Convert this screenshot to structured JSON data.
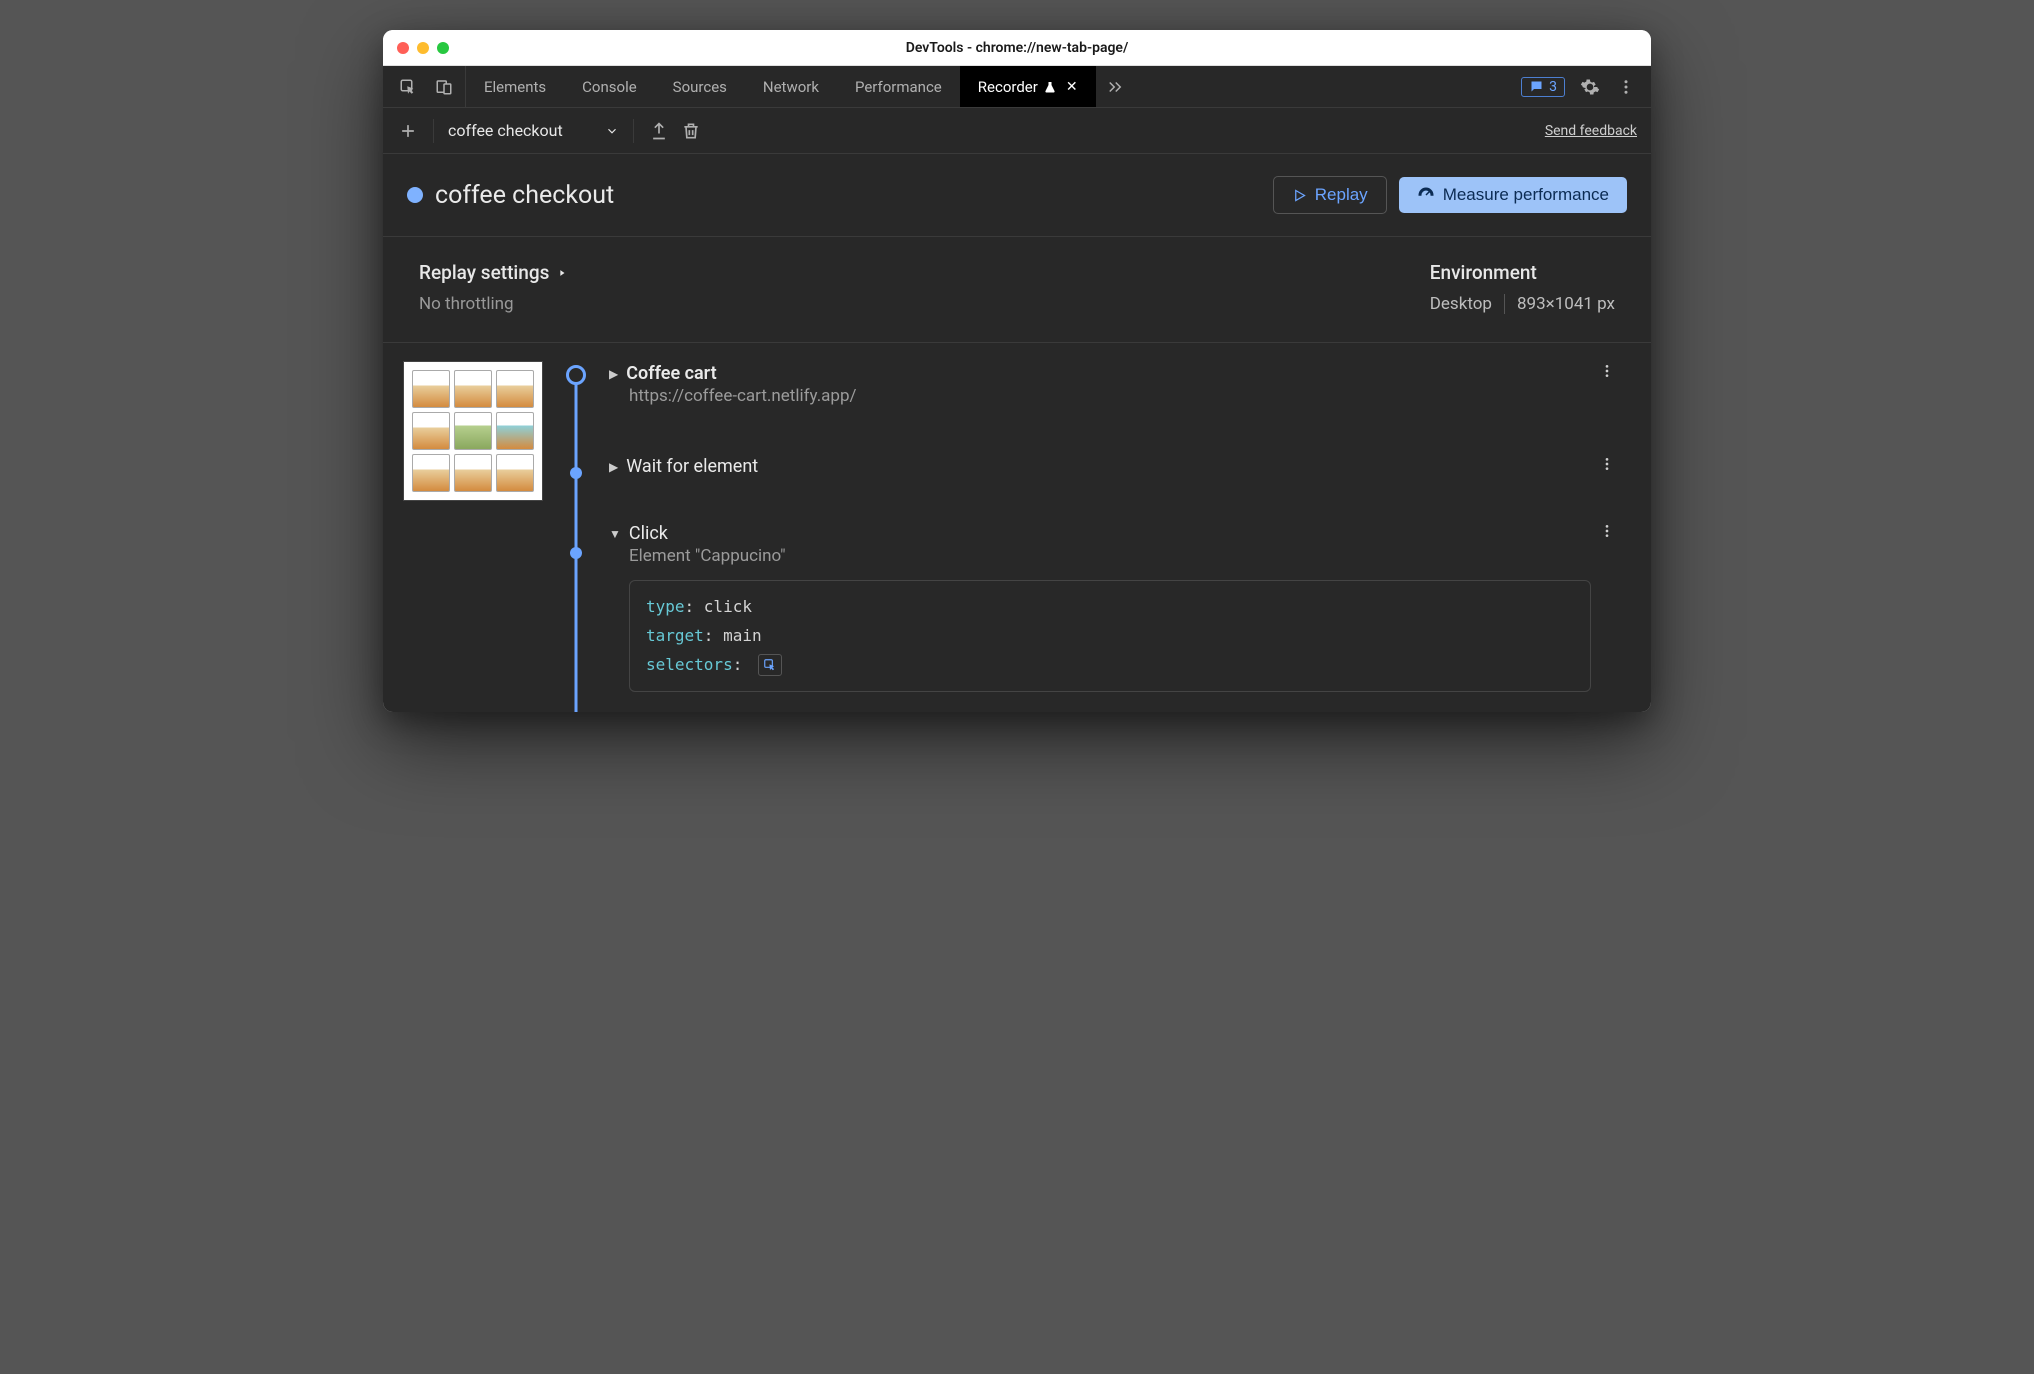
{
  "window": {
    "title": "DevTools - chrome://new-tab-page/"
  },
  "tabs": {
    "items": [
      "Elements",
      "Console",
      "Sources",
      "Network",
      "Performance",
      "Recorder"
    ],
    "active": "Recorder"
  },
  "issues": {
    "count": "3"
  },
  "toolbar": {
    "recording_name": "coffee checkout",
    "send_feedback": "Send feedback"
  },
  "recording": {
    "title": "coffee checkout",
    "replay_label": "Replay",
    "measure_label": "Measure performance"
  },
  "settings": {
    "replay_heading": "Replay settings",
    "throttling": "No throttling",
    "env_heading": "Environment",
    "device": "Desktop",
    "viewport": "893×1041 px"
  },
  "steps": {
    "s0": {
      "title": "Coffee cart",
      "url": "https://coffee-cart.netlify.app/"
    },
    "s1": {
      "title": "Wait for element"
    },
    "s2": {
      "title": "Click",
      "sub": "Element \"Cappucino\"",
      "details": {
        "k_type": "type",
        "v_type": "click",
        "k_target": "target",
        "v_target": "main",
        "k_selectors": "selectors"
      }
    }
  }
}
